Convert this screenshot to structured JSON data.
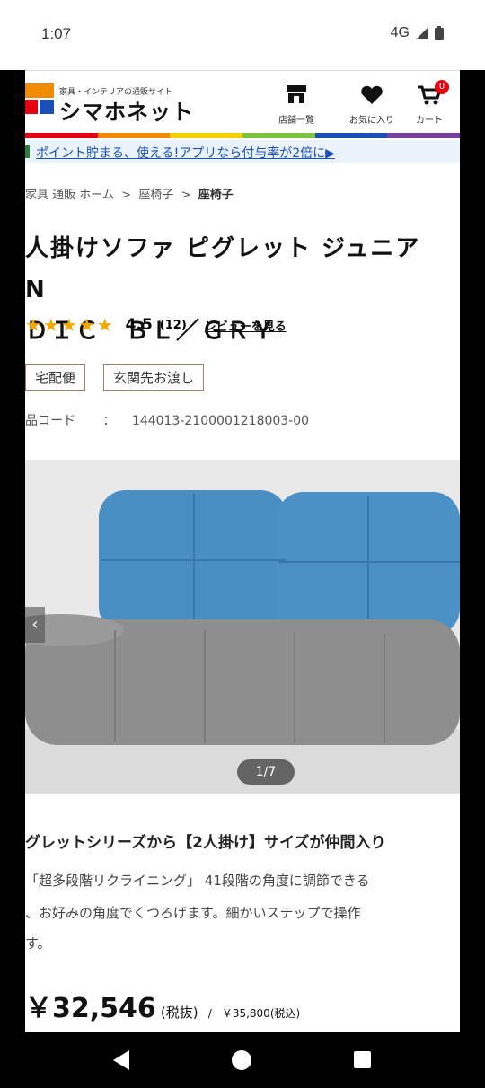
{
  "status_bar": {
    "time": "1:07",
    "network": "4G"
  },
  "header": {
    "logo_subtitle": "家具・インテリアの通販サイト",
    "logo_title": "シマホネット",
    "store_list_label": "店舗一覧",
    "favorites_label": "お気に入り",
    "cart_label": "カート",
    "cart_count": "0"
  },
  "promo_banner": "ポイント貯まる、使える!アプリなら付与率が2倍に▶",
  "breadcrumb": {
    "item1": "家具 通販 ホーム",
    "sep": ">",
    "item2": "座椅子",
    "item3": "座椅子"
  },
  "product": {
    "title_line1": "人掛けソファ ピグレット ジュニア　N",
    "title_line2": "ＤＩＣ　ＢＬ／ＧＲＹ",
    "stars": "★★★★★",
    "rating": "4.5",
    "review_count": "(12)",
    "review_link": "レビューを見る",
    "tag_delivery": "宅配便",
    "tag_handover": "玄関先お渡し",
    "code_label": "品コード",
    "code_sep": "：",
    "code_value": "144013-2100001218003-00",
    "image_counter": "1/7",
    "carousel_prev": "‹"
  },
  "description": {
    "title": "グレットシリーズから【2人掛け】サイズが仲間入り",
    "line1": "「超多段階リクライニング」 41段階の角度に調節できる",
    "line2": "、お好みの角度でくつろげます。細かいステップで操作",
    "line3": "す。"
  },
  "price": {
    "main": "￥32,546",
    "tax_note": "(税抜)",
    "slash": "/",
    "incl_tax": "￥35,800(税込)"
  },
  "colors": {
    "accent_red": "#e60012",
    "link_blue": "#1a4fb8",
    "star_gold": "#f2a800",
    "tag_border": "#a08060"
  }
}
